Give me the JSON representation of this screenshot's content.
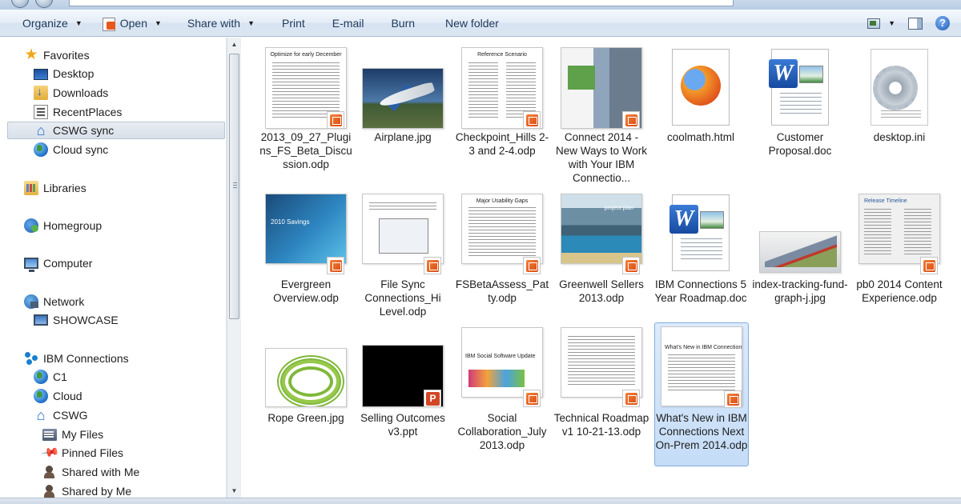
{
  "toolbar": {
    "organize": "Organize",
    "open": "Open",
    "share_with": "Share with",
    "print": "Print",
    "email": "E-mail",
    "burn": "Burn",
    "new_folder": "New folder"
  },
  "nav": {
    "favorites": "Favorites",
    "desktop": "Desktop",
    "downloads": "Downloads",
    "recent_places": "RecentPlaces",
    "cswg_sync": "CSWG sync",
    "cloud_sync": "Cloud sync",
    "libraries": "Libraries",
    "homegroup": "Homegroup",
    "computer": "Computer",
    "network": "Network",
    "showcase": "SHOWCASE",
    "ibm_connections": "IBM Connections",
    "c1": "C1",
    "cloud": "Cloud",
    "cswg": "CSWG",
    "my_files": "My Files",
    "pinned_files": "Pinned Files",
    "shared_with_me": "Shared with Me",
    "shared_by_me": "Shared by Me"
  },
  "thumb_text": {
    "f0_title": "Optimize for early December",
    "f2_title": "Reference Scenario",
    "f7_title": "2010 Savings",
    "f10_title": "Major Usability Gaps",
    "f11_title": "project plan",
    "f15_title": "Release Timeline",
    "f18_title": "IBM Social Software Update",
    "f20_title": "What's New in IBM Connections"
  },
  "files": [
    {
      "label": "2013_09_27_Plugins_FS_Beta_Discussion.odp"
    },
    {
      "label": "Airplane.jpg"
    },
    {
      "label": "Checkpoint_Hills 2-3 and 2-4.odp"
    },
    {
      "label": "Connect 2014 - New Ways to Work with Your IBM Connectio..."
    },
    {
      "label": "coolmath.html"
    },
    {
      "label": "Customer Proposal.doc"
    },
    {
      "label": "desktop.ini"
    },
    {
      "label": "Evergreen Overview.odp"
    },
    {
      "label": "File Sync Connections_Hi Level.odp"
    },
    {
      "label": "FSBetaAssess_Patty.odp"
    },
    {
      "label": "Greenwell Sellers 2013.odp"
    },
    {
      "label": "IBM Connections 5 Year Roadmap.doc"
    },
    {
      "label": "index-tracking-fund-graph-j.jpg"
    },
    {
      "label": "pb0 2014 Content Experience.odp"
    },
    {
      "label": "Rope Green.jpg"
    },
    {
      "label": "Selling Outcomes v3.ppt"
    },
    {
      "label": "Social Collaboration_July 2013.odp"
    },
    {
      "label": "Technical Roadmap v1 10-21-13.odp"
    },
    {
      "label": "What's New in IBM Connections Next On-Prem 2014.odp"
    }
  ]
}
